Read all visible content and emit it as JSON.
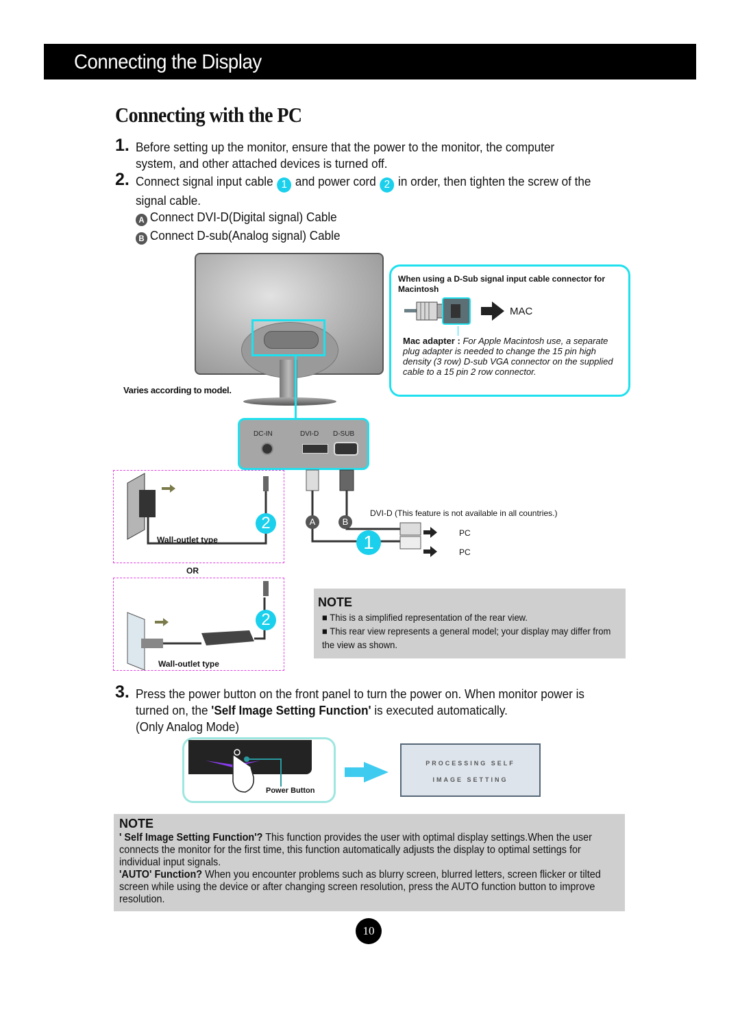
{
  "header": {
    "title": "Connecting the Display"
  },
  "page_title": "Connecting with the PC",
  "steps": {
    "s1": {
      "number": "1.",
      "text": "Before setting up the monitor, ensure that the power to the monitor, the computer system, and other attached devices is turned off."
    },
    "s2": {
      "number": "2.",
      "text_a": "Connect signal input cable",
      "badge1": "1",
      "text_b": "and power cord",
      "badge2": "2",
      "text_c": "in order, then tighten the screw of the signal cable."
    },
    "s2_sub": [
      {
        "badge": "A",
        "text": "Connect DVI-D(Digital signal) Cable"
      },
      {
        "badge": "B",
        "text": "Connect D-sub(Analog signal) Cable"
      }
    ],
    "s3": {
      "number": "3.",
      "text_a": "Press the power button on the front panel to turn the power on. When monitor power is turned on, the ",
      "bold": "'Self Image Setting Function'",
      "text_b": " is executed automatically.",
      "mode": "(Only Analog Mode)"
    }
  },
  "diagram": {
    "varies_label": "Varies according to model.",
    "mac": {
      "heading": "When using a D-Sub signal input cable connector for Macintosh",
      "target_label": "MAC",
      "adapter_label": "Mac adapter :",
      "adapter_desc": "For Apple Macintosh use, a separate plug adapter is needed to change the 15 pin high density (3 row) D-sub VGA connector on the supplied cable to a 15 pin  2 row connector."
    },
    "ports": {
      "dc_in": "DC-IN",
      "dvi_d": "DVI-D",
      "d_sub": "D-SUB"
    },
    "power": {
      "wall_label_1": "Wall-outlet type",
      "or_label": "OR",
      "wall_label_2": "Wall-outlet type",
      "badge": "2"
    },
    "cables": {
      "badge_a": "A",
      "badge_b": "B",
      "badge_1": "1",
      "dvi_note": "DVI-D (This feature is not available in all countries.)",
      "pc1": "PC",
      "pc2": "PC"
    }
  },
  "note1": {
    "title": "NOTE",
    "items": [
      "This is a simplified representation of the rear view.",
      "This rear view represents a general model; your display may differ from the view as shown."
    ]
  },
  "power_illustration": {
    "button_label": "Power Button",
    "osd_line1": "PROCESSING SELF",
    "osd_line2": "IMAGE SETTING"
  },
  "note2": {
    "title": "NOTE",
    "q1_bold": "' Self Image Setting Function'?",
    "q1_text": " This function provides the user with optimal display settings.When the user connects the monitor for the first time, this function automatically adjusts the display to optimal settings for individual input signals.",
    "q2_bold": "'AUTO' Function?",
    "q2_text": " When you encounter problems such as blurry screen, blurred letters, screen flicker or tilted screen while using the device or after changing screen resolution, press the AUTO function button to improve resolution."
  },
  "page_number": "10",
  "colors": {
    "accent_cyan": "#1fe0ee",
    "note_bg": "#cfcfcf",
    "header_bg": "#000000"
  }
}
